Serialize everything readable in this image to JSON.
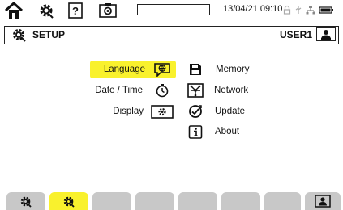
{
  "status_bar": {
    "datetime": "13/04/21 09:10",
    "progress_percent": 0,
    "icons": [
      "home-icon",
      "setup-gear-icon",
      "help-icon",
      "screenshot-icon",
      "lock-icon",
      "usb-icon",
      "network-icon",
      "battery-icon"
    ]
  },
  "header": {
    "title": "SETUP",
    "user": "USER1"
  },
  "menu": {
    "left": [
      {
        "label": "Language",
        "icon": "language-icon",
        "selected": true
      },
      {
        "label": "Date / Time",
        "icon": "clock-icon",
        "selected": false
      },
      {
        "label": "Display",
        "icon": "display-icon",
        "selected": false
      }
    ],
    "right": [
      {
        "label": "Memory",
        "icon": "save-icon"
      },
      {
        "label": "Network",
        "icon": "network-icon"
      },
      {
        "label": "Update",
        "icon": "update-icon"
      },
      {
        "label": "About",
        "icon": "info-icon"
      }
    ]
  },
  "tabs": {
    "count": 8,
    "active_index": 1,
    "icons": [
      "gear-icon",
      "gear-icon",
      "",
      "",
      "",
      "",
      "",
      "user-icon"
    ]
  },
  "colors": {
    "accent": "#f9f12d",
    "tab_inactive": "#c8c8c8",
    "border": "#222222"
  }
}
